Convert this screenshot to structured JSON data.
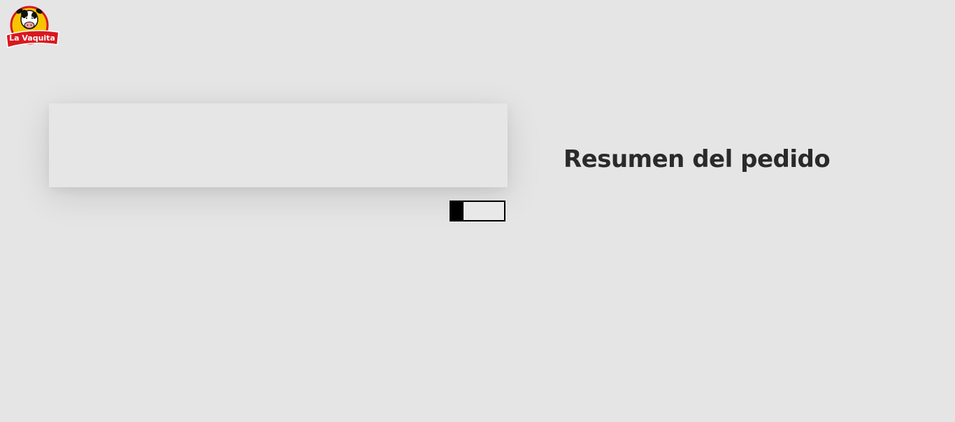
{
  "header": {
    "logo": {
      "brand_text": "La Vaquita",
      "icon": "cow-logo-icon",
      "colors": {
        "badge_red": "#d71920",
        "badge_yellow": "#f6c500"
      }
    }
  },
  "order_summary": {
    "title": "Resumen del pedido"
  },
  "toggle": {
    "state": "off"
  }
}
